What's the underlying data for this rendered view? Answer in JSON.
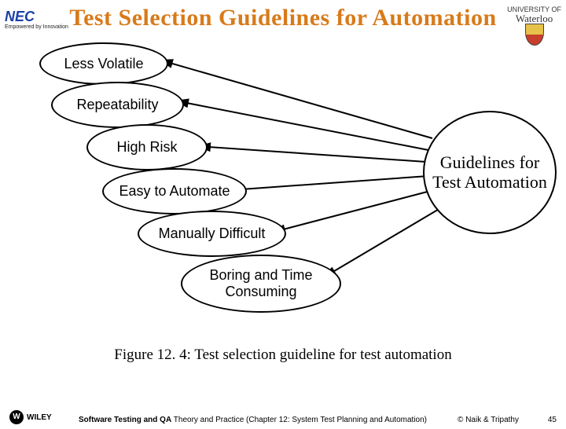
{
  "title": "Test Selection Guidelines for Automation",
  "logos": {
    "nec_brand": "NEC",
    "nec_tag": "Empowered by Innovation",
    "waterloo_top": "UNIVERSITY OF",
    "waterloo_name": "Waterloo"
  },
  "hub": "Guidelines for Test Automation",
  "guidelines": [
    "Less Volatile",
    "Repeatability",
    "High Risk",
    "Easy to Automate",
    "Manually Difficult",
    "Boring and Time Consuming"
  ],
  "caption": "Figure 12. 4: Test selection guideline for test automation",
  "footer": {
    "wiley": "WILEY",
    "book_bold": "Software Testing and QA",
    "book_rest": " Theory and Practice (Chapter 12: System Test Planning and Automation)",
    "copyright": "© Naik & Tripathy",
    "page": "45"
  }
}
